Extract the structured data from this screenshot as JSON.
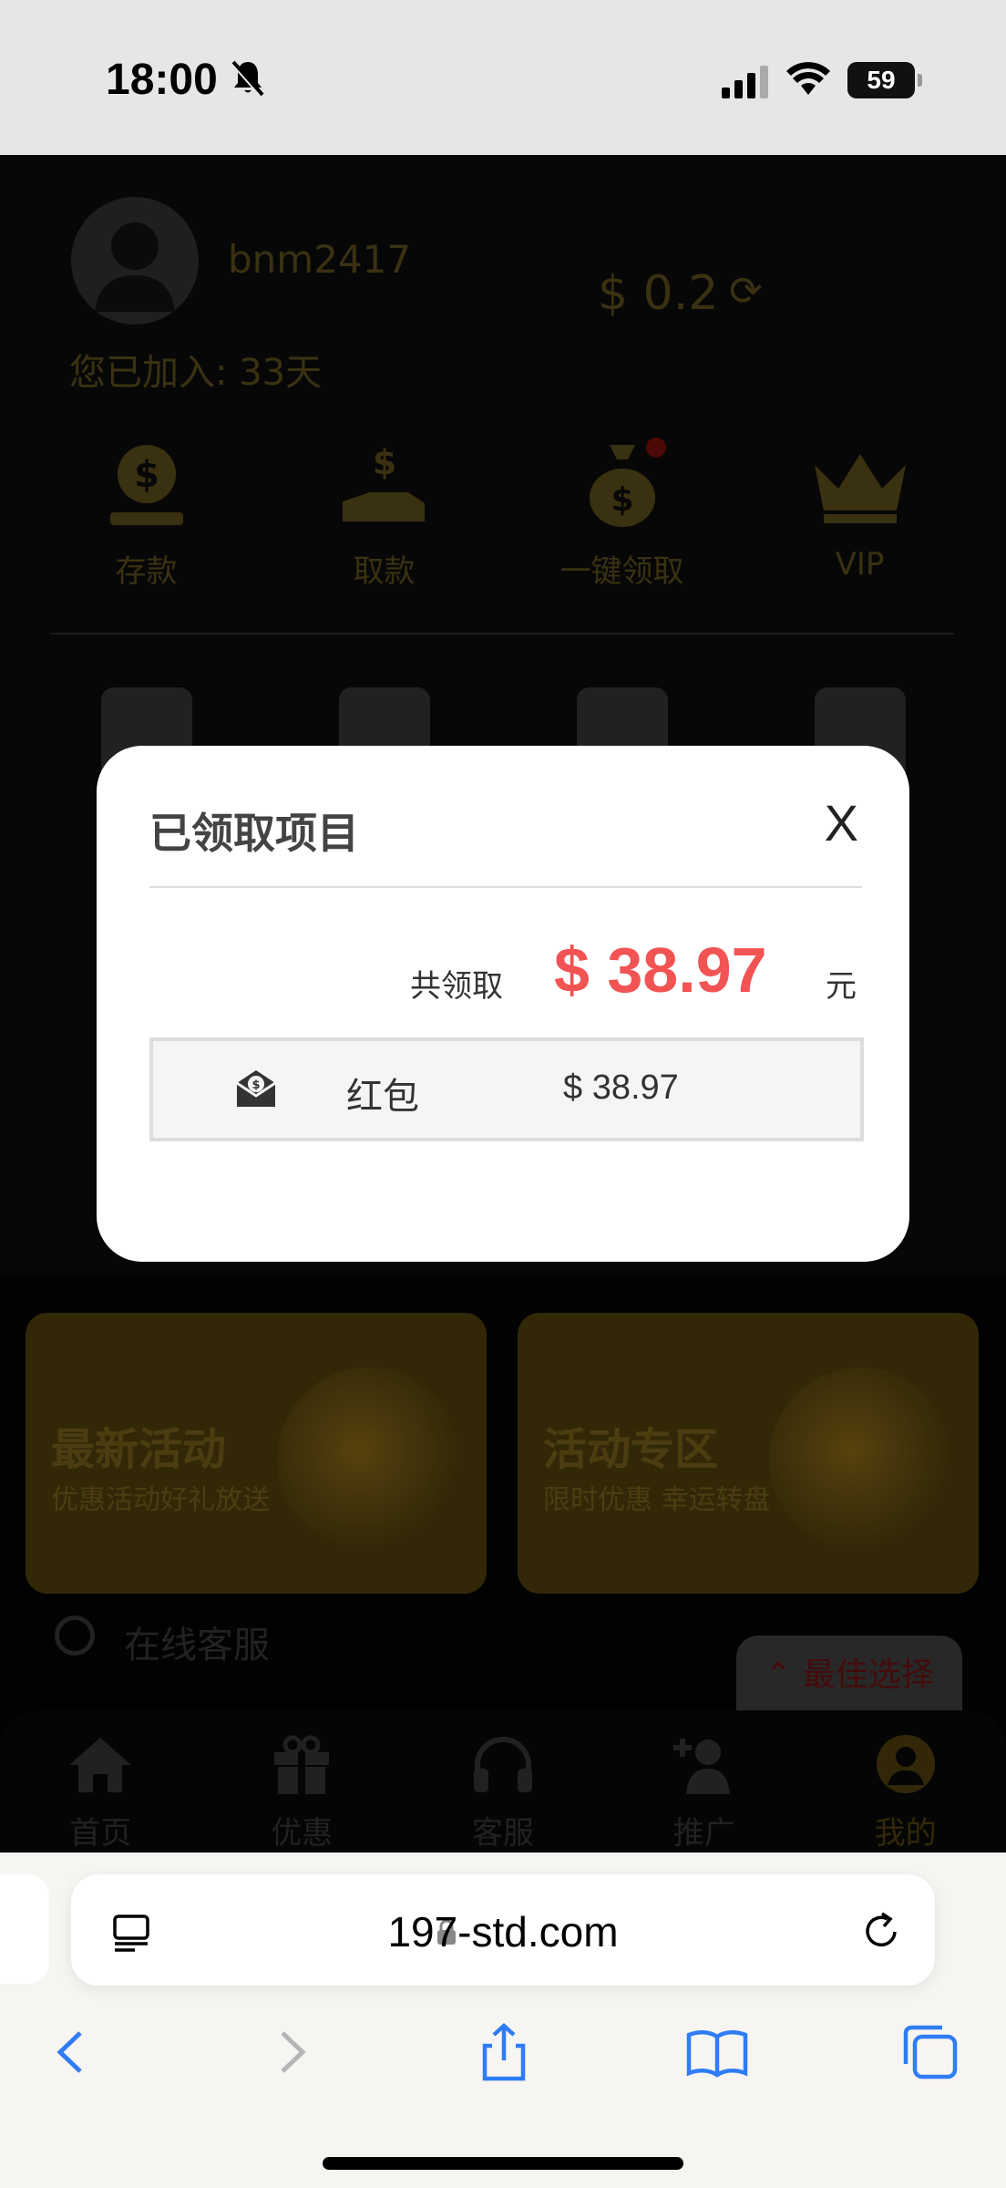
{
  "status_bar": {
    "time": "18:00",
    "battery": "59"
  },
  "profile": {
    "username": "bnm2417",
    "balance": "$ 0.2",
    "joined": "您已加入: 33天"
  },
  "actions": [
    {
      "label": "存款",
      "icon": "deposit-icon"
    },
    {
      "label": "取款",
      "icon": "withdraw-icon"
    },
    {
      "label": "一键领取",
      "icon": "money-bag-icon"
    },
    {
      "label": "VIP",
      "icon": "crown-icon"
    }
  ],
  "promos": [
    {
      "title": "最新活动",
      "subtitle": "优惠活动好礼放送"
    },
    {
      "title": "活动专区",
      "subtitle": "限时优惠 幸运转盘"
    }
  ],
  "service": {
    "label": "在线客服"
  },
  "best_choice": {
    "label": "最佳选择"
  },
  "tabs": [
    {
      "label": "首页",
      "icon": "home-icon"
    },
    {
      "label": "优惠",
      "icon": "gift-icon"
    },
    {
      "label": "客服",
      "icon": "headset-icon"
    },
    {
      "label": "推广",
      "icon": "add-user-icon"
    },
    {
      "label": "我的",
      "icon": "user-icon"
    }
  ],
  "browser": {
    "url": "197-std.com"
  },
  "modal": {
    "title": "已领取项目",
    "close": "X",
    "total_label": "共领取",
    "total_amount": "$ 38.97",
    "total_unit": "元",
    "items": [
      {
        "name": "红包",
        "amount": "$ 38.97"
      }
    ]
  },
  "colors": {
    "accent_red": "#f25353",
    "gold_dim": "#6b5a20"
  }
}
